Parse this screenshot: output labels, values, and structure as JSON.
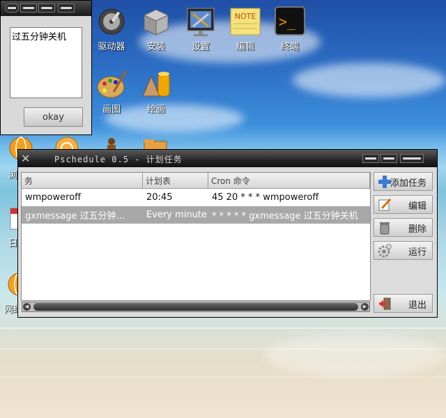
{
  "desktop": {
    "icons": [
      {
        "label": "驱动器"
      },
      {
        "label": "安装"
      },
      {
        "label": "设置"
      },
      {
        "label": "编辑"
      },
      {
        "label": "终端"
      },
      {
        "label": "画图"
      },
      {
        "label": "绘画"
      }
    ],
    "partial_labels": [
      "浏",
      "日",
      "网络"
    ],
    "note_icon_text": "NOTE",
    "terminal_icon_text": ">_"
  },
  "message_window": {
    "text": "过五分钟关机",
    "ok_label": "okay"
  },
  "main_window": {
    "title": "Pschedule 0.5 - 计划任务",
    "columns": [
      "务",
      "计划表",
      "Cron 命令"
    ],
    "rows": [
      {
        "task": "wmpoweroff",
        "schedule": "20:45",
        "cron": "45 20 * * * wmpoweroff",
        "selected": false
      },
      {
        "task": "gxmessage 过五分钟…",
        "schedule": "Every minute",
        "cron": "* * * * * gxmessage 过五分钟关机",
        "selected": true
      }
    ],
    "buttons": {
      "add": "添加任务",
      "edit": "编辑",
      "delete": "删除",
      "run": "运行",
      "quit": "退出"
    }
  },
  "colors": {
    "selection": "#a8a8a8",
    "titlebar": "#262626"
  }
}
